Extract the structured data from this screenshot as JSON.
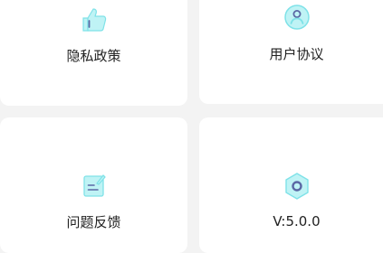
{
  "menu": {
    "items": [
      {
        "label": "隐私政策",
        "icon": "thumbs-up-icon"
      },
      {
        "label": "用户协议",
        "icon": "user-circle-icon"
      },
      {
        "label": "问题反馈",
        "icon": "edit-note-icon"
      },
      {
        "label": "V:5.0.0",
        "icon": "hexagon-icon"
      }
    ]
  },
  "colors": {
    "icon_fill": "#bff3f5",
    "icon_stroke": "#5b68a5",
    "card_background": "#ffffff",
    "page_background": "#f3f3f3"
  }
}
